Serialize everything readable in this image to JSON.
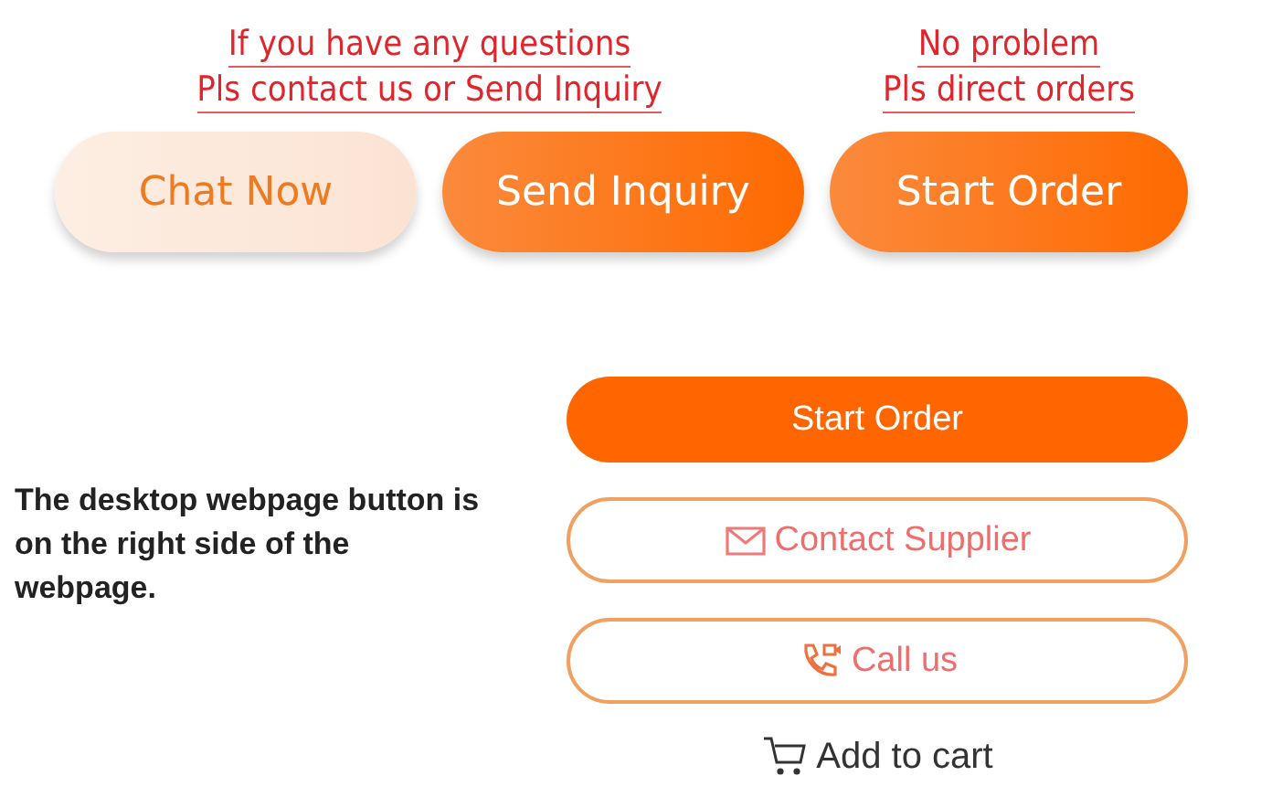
{
  "notes": [
    {
      "lines": [
        "If you have any questions",
        "Pls contact us or Send Inquiry"
      ]
    },
    {
      "lines": [
        "No problem",
        "Pls direct orders"
      ]
    }
  ],
  "mobile_buttons": [
    {
      "label": "Chat Now",
      "kind": "light"
    },
    {
      "label": "Send Inquiry",
      "kind": "gradient"
    },
    {
      "label": "Start Order",
      "kind": "gradient"
    }
  ],
  "caption": "The desktop webpage button is on the right side of the webpage.",
  "desktop_buttons": [
    {
      "label": "Start Order",
      "kind": "filled"
    },
    {
      "label": "Contact Supplier",
      "kind": "mail"
    },
    {
      "label": "Call us",
      "kind": "phone"
    },
    {
      "label": "Add to cart",
      "kind": "cart"
    }
  ]
}
